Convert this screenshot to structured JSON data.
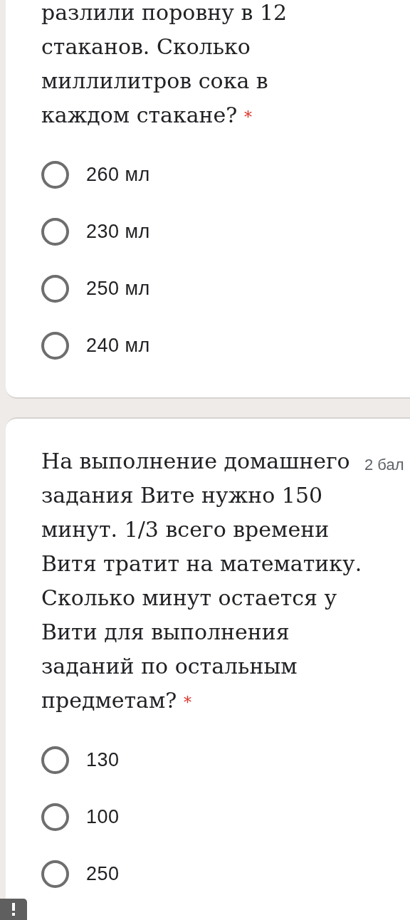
{
  "questions": [
    {
      "text": "разлили поровну в 12 стаканов. Сколько миллилитров сока в каждом стакане?",
      "required_mark": "*",
      "options": [
        {
          "label": "260 мл",
          "selected": false
        },
        {
          "label": "230 мл",
          "selected": false
        },
        {
          "label": "250 мл",
          "selected": false
        },
        {
          "label": "240 мл",
          "selected": false
        }
      ]
    },
    {
      "text": "На выполнение домашнего задания Вите нужно 150 минут. 1/3 всего времени Витя тратит на математику. Сколько минут остается у Вити для выполнения заданий по остальным предметам?",
      "required_mark": "*",
      "points": "2 бал",
      "options": [
        {
          "label": "130",
          "selected": false
        },
        {
          "label": "100",
          "selected": false
        },
        {
          "label": "250",
          "selected": false
        }
      ]
    }
  ]
}
